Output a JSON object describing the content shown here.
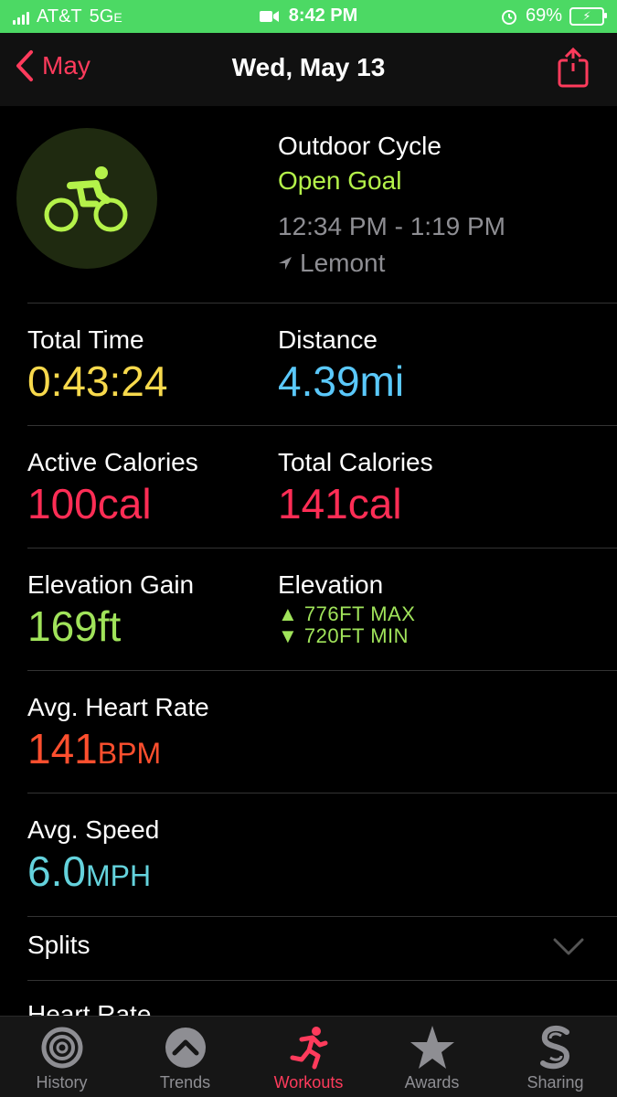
{
  "status": {
    "carrier": "AT&T",
    "network": "5G",
    "network_suffix": "E",
    "time": "8:42 PM",
    "battery_percent": "69%"
  },
  "nav": {
    "back_label": "May",
    "title": "Wed, May 13"
  },
  "workout": {
    "type": "Outdoor Cycle",
    "goal": "Open Goal",
    "time_range": "12:34 PM - 1:19 PM",
    "location": "Lemont"
  },
  "metrics": {
    "total_time": {
      "label": "Total Time",
      "value": "0:43:24",
      "color": "#f7d94c"
    },
    "distance": {
      "label": "Distance",
      "value": "4.39mi",
      "color": "#5ac8fa"
    },
    "active_calories": {
      "label": "Active Calories",
      "value": "100cal",
      "color": "#ff2d55"
    },
    "total_calories": {
      "label": "Total Calories",
      "value": "141cal",
      "color": "#ff2d55"
    },
    "elevation_gain": {
      "label": "Elevation Gain",
      "value": "169ft",
      "color": "#a0e35a"
    },
    "elevation": {
      "label": "Elevation",
      "max": "776FT MAX",
      "min": "720FT MIN"
    },
    "avg_heart_rate": {
      "label": "Avg. Heart Rate",
      "value": "141",
      "unit": "BPM",
      "color": "#ff4f2e"
    },
    "avg_speed": {
      "label": "Avg. Speed",
      "value": "6.0",
      "unit": "MPH",
      "color": "#64d2dc"
    }
  },
  "sections": {
    "splits": "Splits",
    "heart_rate": "Heart Rate"
  },
  "tabs": [
    {
      "label": "History",
      "icon": "history-rings-icon"
    },
    {
      "label": "Trends",
      "icon": "trends-chevron-icon"
    },
    {
      "label": "Workouts",
      "icon": "running-figure-icon"
    },
    {
      "label": "Awards",
      "icon": "star-award-icon"
    },
    {
      "label": "Sharing",
      "icon": "sharing-s-icon"
    }
  ],
  "colors": {
    "accent_red": "#ff3b5c",
    "status_green": "#4cd964",
    "goal_green": "#b4f24a"
  }
}
